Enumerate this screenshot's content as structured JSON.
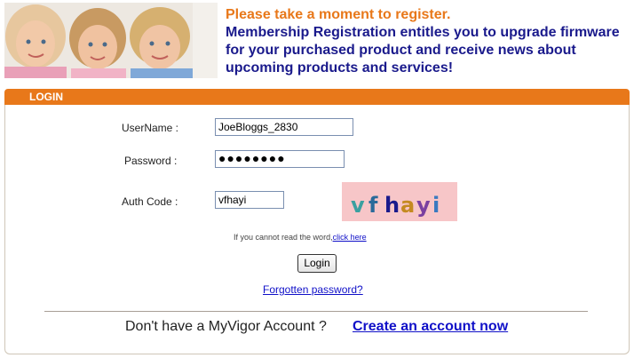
{
  "header": {
    "title": "Please take a moment to register.",
    "message_lines": [
      "Membership Registration entitles you to upgrade firmware",
      "for your purchased product and receive news about",
      "upcoming products and services!"
    ]
  },
  "login": {
    "panel_title": "LOGIN",
    "username_label": "UserName :",
    "username_value": "JoeBloggs_2830",
    "password_label": "Password :",
    "password_value": "●●●●●●●●",
    "authcode_label": "Auth Code :",
    "authcode_value": "vfhayi",
    "captcha_chars": [
      "v",
      "f",
      "h",
      "a",
      "y",
      "i"
    ],
    "captcha_colors": [
      "#3aa0a0",
      "#2a6a9a",
      "#1a1a8c",
      "#c48a20",
      "#7a40a0",
      "#3a7ac0"
    ],
    "cannot_read_text": "If you cannot read the word,",
    "click_here_link": "click here",
    "login_button": "Login",
    "forgot_link": "Forgotten password?"
  },
  "footer": {
    "no_account_text": "Don't have a MyVigor Account ?",
    "create_link": "Create an account now"
  },
  "colors": {
    "accent": "#e8781a",
    "heading_blue": "#1a1a8c",
    "link_blue": "#1010c8",
    "captcha_bg": "#f7c6c8"
  }
}
